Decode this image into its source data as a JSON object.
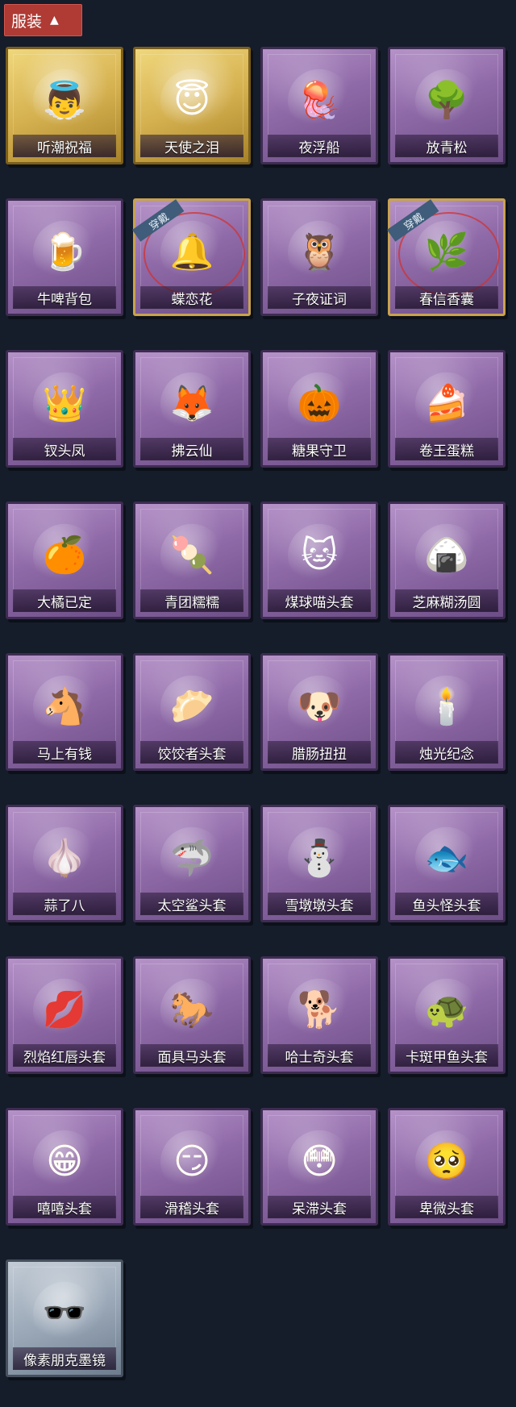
{
  "header": {
    "title": "服装",
    "toggle_icon": "chevron-up-icon"
  },
  "worn_label": "穿戴",
  "items": [
    {
      "name": "听潮祝福",
      "frame": "gold",
      "icon": "angel-mannequin-icon",
      "glyph": "👼",
      "art_color": "#f2c9c4",
      "worn": false
    },
    {
      "name": "天使之泪",
      "frame": "gold",
      "icon": "angel-wings-icon",
      "glyph": "😇",
      "art_color": "#f7d6cf",
      "worn": false
    },
    {
      "name": "夜浮船",
      "frame": "purple",
      "icon": "jellyfish-icon",
      "glyph": "🪼",
      "art_color": "#a9d6f2",
      "worn": false
    },
    {
      "name": "放青松",
      "frame": "purple",
      "icon": "bonsai-tree-icon",
      "glyph": "🌳",
      "art_color": "#6fa760",
      "worn": false
    },
    {
      "name": "牛啤背包",
      "frame": "purple",
      "icon": "beer-barrel-backpack-icon",
      "glyph": "🍺",
      "art_color": "#f3e4d7",
      "worn": false
    },
    {
      "name": "蝶恋花",
      "frame": "purple",
      "icon": "bell-charm-icon",
      "glyph": "🔔",
      "art_color": "#d7b869",
      "worn": true
    },
    {
      "name": "子夜证词",
      "frame": "purple",
      "icon": "owl-figure-icon",
      "glyph": "🦉",
      "art_color": "#3b3550",
      "worn": false
    },
    {
      "name": "春信香囊",
      "frame": "purple",
      "icon": "sachet-icon",
      "glyph": "🌿",
      "art_color": "#b8d8a4",
      "worn": true
    },
    {
      "name": "钗头凤",
      "frame": "purple",
      "icon": "opera-figure-icon",
      "glyph": "👑",
      "art_color": "#d9a64b",
      "worn": false
    },
    {
      "name": "拂云仙",
      "frame": "purple",
      "icon": "fox-charm-icon",
      "glyph": "🦊",
      "art_color": "#e9dede",
      "worn": false
    },
    {
      "name": "糖果守卫",
      "frame": "purple",
      "icon": "pumpkin-scarecrow-icon",
      "glyph": "🎃",
      "art_color": "#d67b2c",
      "worn": false
    },
    {
      "name": "卷王蛋糕",
      "frame": "purple",
      "icon": "roll-cake-icon",
      "glyph": "🍰",
      "art_color": "#e69a4a",
      "worn": false
    },
    {
      "name": "大橘已定",
      "frame": "purple",
      "icon": "orange-slice-icon",
      "glyph": "🍊",
      "art_color": "#ee8b2a",
      "worn": false
    },
    {
      "name": "青团糯糯",
      "frame": "purple",
      "icon": "green-dumpling-icon",
      "glyph": "🍡",
      "art_color": "#5dbb3f",
      "worn": false
    },
    {
      "name": "煤球喵头套",
      "frame": "purple",
      "icon": "cat-head-icon",
      "glyph": "🐱",
      "art_color": "#55607a",
      "worn": false
    },
    {
      "name": "芝麻糊汤圆",
      "frame": "purple",
      "icon": "rice-ball-icon",
      "glyph": "🍙",
      "art_color": "#f1f3f7",
      "worn": false
    },
    {
      "name": "马上有钱",
      "frame": "purple",
      "icon": "red-horse-head-icon",
      "glyph": "🐴",
      "art_color": "#d63b4a",
      "worn": false
    },
    {
      "name": "饺饺者头套",
      "frame": "purple",
      "icon": "dumpling-head-icon",
      "glyph": "🥟",
      "art_color": "#f3f1ea",
      "worn": false
    },
    {
      "name": "腊肠扭扭",
      "frame": "purple",
      "icon": "dog-head-icon",
      "glyph": "🐶",
      "art_color": "#8a5a34",
      "worn": false
    },
    {
      "name": "烛光纪念",
      "frame": "purple",
      "icon": "candle-head-icon",
      "glyph": "🕯️",
      "art_color": "#f3d8c6",
      "worn": false
    },
    {
      "name": "蒜了八",
      "frame": "purple",
      "icon": "garlic-head-icon",
      "glyph": "🧄",
      "art_color": "#efe5d6",
      "worn": false
    },
    {
      "name": "太空鲨头套",
      "frame": "purple",
      "icon": "shark-head-icon",
      "glyph": "🦈",
      "art_color": "#9cc4ee",
      "worn": false
    },
    {
      "name": "雪墩墩头套",
      "frame": "purple",
      "icon": "snowman-head-icon",
      "glyph": "⛄",
      "art_color": "#ffffff",
      "worn": false
    },
    {
      "name": "鱼头怪头套",
      "frame": "purple",
      "icon": "fish-head-icon",
      "glyph": "🐟",
      "art_color": "#4f8a3b",
      "worn": false
    },
    {
      "name": "烈焰红唇头套",
      "frame": "purple",
      "icon": "yellow-mouse-mask-icon",
      "glyph": "💋",
      "art_color": "#e7c33a",
      "worn": false
    },
    {
      "name": "面具马头套",
      "frame": "purple",
      "icon": "horse-mask-icon",
      "glyph": "🐎",
      "art_color": "#6b3a26",
      "worn": false
    },
    {
      "name": "哈士奇头套",
      "frame": "purple",
      "icon": "husky-head-icon",
      "glyph": "🐕",
      "art_color": "#7a5a3b",
      "worn": false
    },
    {
      "name": "卡斑甲鱼头套",
      "frame": "purple",
      "icon": "turtle-head-icon",
      "glyph": "🐢",
      "art_color": "#5f6f88",
      "worn": false
    },
    {
      "name": "嘻嘻头套",
      "frame": "purple",
      "icon": "grinning-face-icon",
      "glyph": "😁",
      "art_color": "#f5c219",
      "worn": false
    },
    {
      "name": "滑稽头套",
      "frame": "purple",
      "icon": "smirk-face-icon",
      "glyph": "😏",
      "art_color": "#f5c219",
      "worn": false
    },
    {
      "name": "呆滞头套",
      "frame": "purple",
      "icon": "dazed-face-icon",
      "glyph": "😳",
      "art_color": "#f5c219",
      "worn": false
    },
    {
      "name": "卑微头套",
      "frame": "purple",
      "icon": "pleading-face-icon",
      "glyph": "🥺",
      "art_color": "#f5c219",
      "worn": false
    },
    {
      "name": "像素朋克墨镜",
      "frame": "silver",
      "icon": "pixel-sunglasses-icon",
      "glyph": "🕶️",
      "art_color": "#1c1c1c",
      "worn": false
    }
  ]
}
